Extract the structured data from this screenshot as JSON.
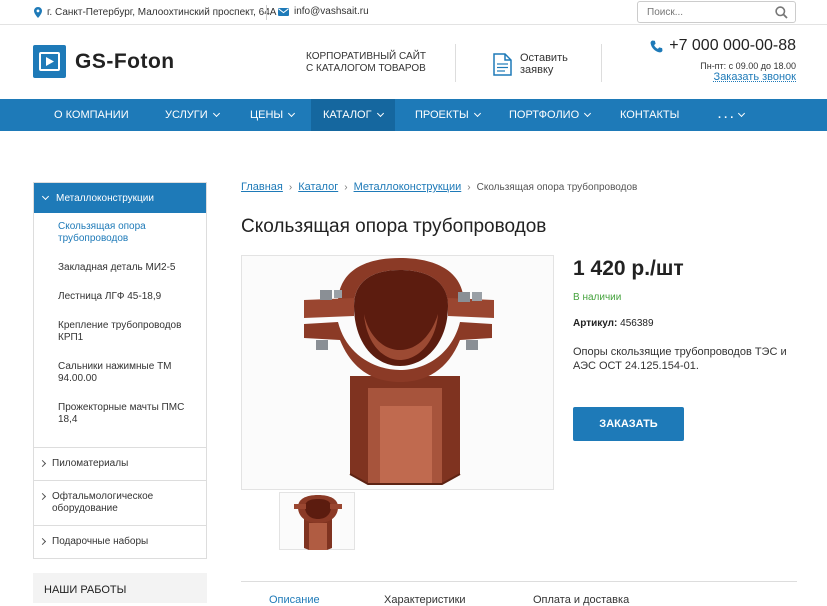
{
  "topbar": {
    "address": "г. Санкт-Петербург, Малоохтинский проспект, 64А",
    "email": "info@vashsait.ru",
    "search_placeholder": "Поиск..."
  },
  "header": {
    "logo_text": "GS-Foton",
    "tagline_1": "Корпоративный сайт",
    "tagline_2": "с каталогом товаров",
    "request_label_1": "Оставить",
    "request_label_2": "заявку",
    "phone": "+7 000 000-00-88",
    "hours": "Пн-пт: с 09.00 до 18.00",
    "callback": "Заказать звонок"
  },
  "nav": {
    "items": [
      {
        "label": "О компании"
      },
      {
        "label": "Услуги"
      },
      {
        "label": "Цены"
      },
      {
        "label": "Каталог"
      },
      {
        "label": "Проекты"
      },
      {
        "label": "Портфолио"
      },
      {
        "label": "Контакты"
      },
      {
        "label": ". . ."
      }
    ],
    "active": "Каталог"
  },
  "sidebar": {
    "open_category": "Металлоконструкции",
    "subitems": [
      {
        "label": "Скользящая опора трубопроводов"
      },
      {
        "label": "Закладная деталь МИ2-5"
      },
      {
        "label": "Лестница ЛГФ 45-18,9"
      },
      {
        "label": "Крепление трубопроводов КРП1"
      },
      {
        "label": "Сальники нажимные ТМ 94.00.00"
      },
      {
        "label": "Прожекторные мачты ПМС 18,4"
      }
    ],
    "categories": [
      {
        "label": "Пиломатериалы"
      },
      {
        "label": "Офтальмологическое оборудование"
      },
      {
        "label": "Подарочные наборы"
      }
    ],
    "works_title": "Наши работы"
  },
  "breadcrumbs": {
    "home": "Главная",
    "catalog": "Каталог",
    "section": "Металлоконструкции",
    "current": "Скользящая опора трубопроводов"
  },
  "product": {
    "title": "Скользящая опора трубопроводов",
    "price": "1 420 р./шт",
    "stock": "В наличии",
    "sku_label": "Артикул:",
    "sku": "456389",
    "description": "Опоры скользящие трубопроводов ТЭС и АЭС ОСТ 24.125.154-01.",
    "order_button": "Заказать"
  },
  "tabs": [
    {
      "label": "Описание"
    },
    {
      "label": "Характеристики"
    },
    {
      "label": "Оплата и доставка"
    }
  ],
  "colors": {
    "accent": "#1e7ab8",
    "in_stock": "#46a33e",
    "product_body": "#8b3a26"
  }
}
